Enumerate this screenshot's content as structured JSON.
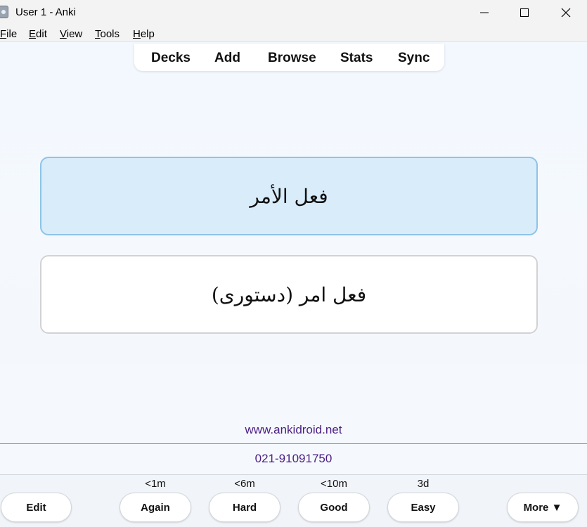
{
  "window": {
    "title": "User 1 - Anki"
  },
  "menu": {
    "file": "File",
    "edit": "Edit",
    "view": "View",
    "tools": "Tools",
    "help": "Help"
  },
  "toolbar": {
    "decks": "Decks",
    "add": "Add",
    "browse": "Browse",
    "stats": "Stats",
    "sync": "Sync"
  },
  "card": {
    "front": "فعل الأمر",
    "back": "فعل امر (دستوری)"
  },
  "footer": {
    "website": "www.ankidroid.net",
    "phone": "021-91091750"
  },
  "answer_bar": {
    "edit_label": "Edit",
    "more_label": "More ▼",
    "buttons": [
      {
        "label": "Again",
        "due": "<1m"
      },
      {
        "label": "Hard",
        "due": "<6m"
      },
      {
        "label": "Good",
        "due": "<10m"
      },
      {
        "label": "Easy",
        "due": "3d"
      }
    ]
  },
  "colors": {
    "link": "#4b1d83",
    "front_card_bg": "#d8ecfa",
    "front_card_border": "#8ec4e6"
  }
}
